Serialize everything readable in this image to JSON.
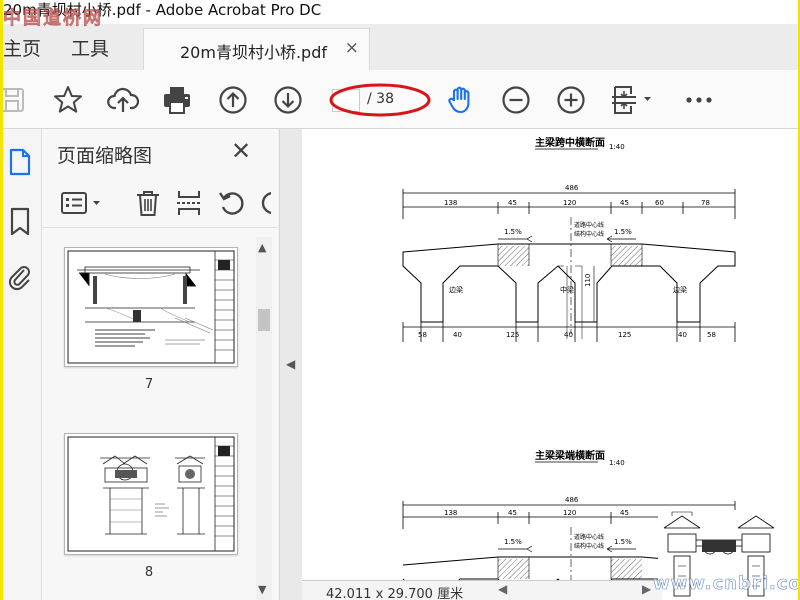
{
  "window": {
    "title": "20m青坝村小桥.pdf - Adobe Acrobat Pro DC"
  },
  "tabs": {
    "home": "主页",
    "tools": "工具",
    "document": "20m青坝村小桥.pdf",
    "close_symbol": "×"
  },
  "toolbar": {
    "icons": [
      "save-icon",
      "star-icon",
      "cloud-upload-icon",
      "print-icon",
      "previous-page-icon",
      "next-page-icon",
      "hand-tool-icon",
      "zoom-out-icon",
      "zoom-in-icon",
      "fit-page-icon",
      "more-icon"
    ],
    "current_page": "",
    "total_pages": "/ 38",
    "active_tool_color": "#1a73e8",
    "annotation_color": "#d7151b"
  },
  "left_nav": {
    "icons": [
      "page-thumbnails-icon",
      "bookmarks-icon",
      "attachments-icon"
    ],
    "accent": "#1a73e8"
  },
  "thumbnails_panel": {
    "title": "页面缩略图",
    "close_symbol": "✕",
    "tools": [
      "options-menu-icon",
      "delete-icon",
      "insert-page-icon",
      "rotate-icon"
    ],
    "pages": [
      {
        "number": "7"
      },
      {
        "number": "8"
      }
    ]
  },
  "document": {
    "drawing1": {
      "title": "主梁跨中横断面",
      "scale": "1:40",
      "total_width": "486",
      "top_dims": [
        "138",
        "45",
        "120",
        "45",
        "60",
        "78"
      ],
      "bottom_dims": [
        "58",
        "40",
        "125",
        "40",
        "125",
        "40",
        "58"
      ],
      "slope_left": "1.5%",
      "slope_right": "1.5%",
      "centerline_1": "道路中心线",
      "centerline_2": "结构中心线",
      "beam_left": "边梁",
      "beam_mid": "中梁",
      "beam_right": "边梁",
      "height": "110"
    },
    "drawing2": {
      "title": "主梁梁端横断面",
      "scale": "1:40",
      "total_width": "486",
      "top_dims": [
        "138",
        "45",
        "120",
        "45"
      ],
      "slope_left": "1.5%",
      "slope_right": "1.5%",
      "centerline_1": "道路中心线",
      "centerline_2": "结构中心线"
    }
  },
  "status": {
    "page_size": "42.011 x 29.700 厘米",
    "scroll_left": "◀",
    "scroll_right": "▶"
  },
  "watermarks": {
    "top_left": "中国道桥网",
    "bottom_right": "www.cnbri.com"
  }
}
